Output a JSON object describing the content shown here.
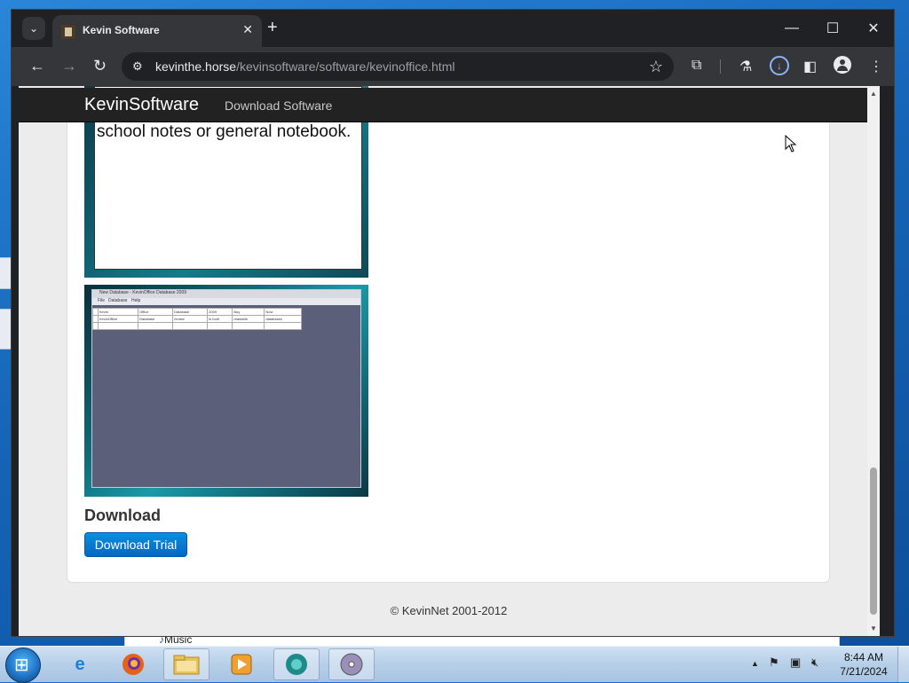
{
  "browser": {
    "tab_title": "Kevin Software",
    "url_host": "kevinthe.horse",
    "url_path": "/kevinsoftware/software/kevinoffice.html"
  },
  "site": {
    "brand": "KevinSoftware",
    "nav_download": "Download Software",
    "screenshot1_text": "school notes or general notebook.",
    "screenshot2": {
      "window_title": "New Database - KevinOffice Database 2009",
      "menu": [
        "File",
        "Database",
        "Help"
      ],
      "grid_rows": [
        [
          "",
          "Kevin",
          "Office",
          "Database",
          "2009",
          "Buy",
          "Now"
        ],
        [
          "",
          "KevinOffice",
          "Database",
          "review",
          "in built",
          "readable",
          "databases"
        ],
        [
          "",
          "",
          "",
          "",
          "",
          "",
          ""
        ]
      ]
    },
    "download_heading": "Download",
    "download_button": "Download Trial",
    "footer": "© KevinNet 2001-2012"
  },
  "desktop": {
    "background_window_item": "Music"
  },
  "taskbar": {
    "time": "8:44 AM",
    "date": "7/21/2024"
  },
  "colors": {
    "button_primary": "#0567c0",
    "nav_bg": "#222222",
    "chrome_toolbar": "#35363a"
  }
}
